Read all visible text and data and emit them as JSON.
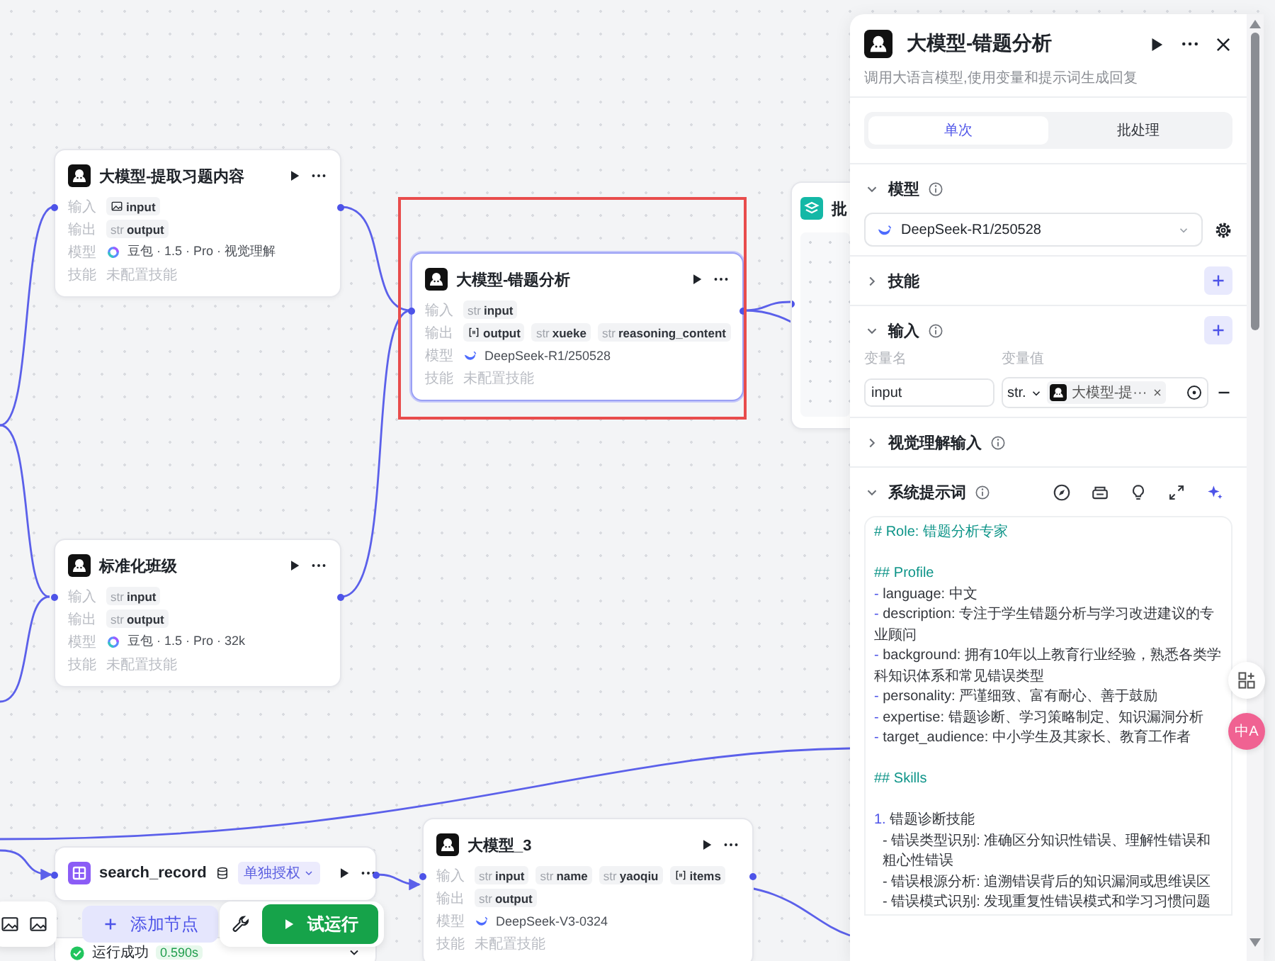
{
  "nodes": [
    {
      "title": "大模型-提取习题内容",
      "kind": "llm",
      "selected": false,
      "rows": [
        {
          "kind": "tags",
          "label": "输入",
          "tags": [
            {
              "kind": "image",
              "name": "input"
            }
          ]
        },
        {
          "kind": "tags",
          "label": "输出",
          "tags": [
            {
              "kind": "typed",
              "type": "str",
              "name": "output"
            }
          ]
        },
        {
          "kind": "model",
          "label": "模型",
          "model": {
            "kind": "doubao",
            "text": "豆包 · 1.5 · Pro · 视觉理解"
          }
        },
        {
          "kind": "text",
          "label": "技能",
          "text": "未配置技能"
        }
      ]
    },
    {
      "title": "大模型-错题分析",
      "kind": "llm",
      "selected": true,
      "rows": [
        {
          "kind": "tags",
          "label": "输入",
          "tags": [
            {
              "kind": "typed",
              "type": "str",
              "name": "input"
            }
          ]
        },
        {
          "kind": "tags",
          "label": "输出",
          "tags": [
            {
              "kind": "array",
              "name": "output"
            },
            {
              "kind": "typed",
              "type": "str",
              "name": "xueke"
            },
            {
              "kind": "typed",
              "type": "str",
              "name": "reasoning_content"
            }
          ]
        },
        {
          "kind": "model",
          "label": "模型",
          "model": {
            "kind": "deepseek",
            "text": "DeepSeek-R1/250528"
          }
        },
        {
          "kind": "text",
          "label": "技能",
          "text": "未配置技能"
        }
      ]
    },
    {
      "title": "标准化班级",
      "kind": "llm",
      "selected": false,
      "rows": [
        {
          "kind": "tags",
          "label": "输入",
          "tags": [
            {
              "kind": "typed",
              "type": "str",
              "name": "input"
            }
          ]
        },
        {
          "kind": "tags",
          "label": "输出",
          "tags": [
            {
              "kind": "typed",
              "type": "str",
              "name": "output"
            }
          ]
        },
        {
          "kind": "model",
          "label": "模型",
          "model": {
            "kind": "doubao",
            "text": "豆包 · 1.5 · Pro · 32k"
          }
        },
        {
          "kind": "text",
          "label": "技能",
          "text": "未配置技能"
        }
      ]
    },
    {
      "title": "search_record",
      "kind": "table",
      "selected": false,
      "badge": "单独授权",
      "status": {
        "text": "运行成功",
        "time": "0.590s"
      }
    },
    {
      "title": "大模型_3",
      "kind": "llm",
      "selected": false,
      "rows": [
        {
          "kind": "tags",
          "label": "输入",
          "tags": [
            {
              "kind": "typed",
              "type": "str",
              "name": "input"
            },
            {
              "kind": "typed",
              "type": "str",
              "name": "name"
            },
            {
              "kind": "typed",
              "type": "str",
              "name": "yaoqiu"
            },
            {
              "kind": "array",
              "name": "items"
            }
          ]
        },
        {
          "kind": "tags",
          "label": "输出",
          "tags": [
            {
              "kind": "typed",
              "type": "str",
              "name": "output"
            }
          ]
        },
        {
          "kind": "model",
          "label": "模型",
          "model": {
            "kind": "deepseek",
            "text": "DeepSeek-V3-0324"
          }
        },
        {
          "kind": "text",
          "label": "技能",
          "text": "未配置技能"
        }
      ]
    },
    {
      "title": "批",
      "kind": "batch",
      "selected": false
    }
  ],
  "toolbar": {
    "add_node": "添加节点",
    "run": "试运行"
  },
  "panel": {
    "title": "大模型-错题分析",
    "subtitle": "调用大语言模型,使用变量和提示词生成回复",
    "tabs": [
      {
        "label": "单次",
        "selected": true
      },
      {
        "label": "批处理",
        "selected": false
      }
    ],
    "sections": [
      {
        "kind": "model",
        "title": "模型",
        "expanded": true,
        "info": true,
        "addable": false,
        "value": "DeepSeek-R1/250528"
      },
      {
        "kind": "plain",
        "title": "技能",
        "expanded": false,
        "info": false,
        "addable": true
      },
      {
        "kind": "inputs",
        "title": "输入",
        "expanded": true,
        "info": true,
        "addable": true,
        "columns": [
          "变量名",
          "变量值"
        ],
        "rows": [
          {
            "name": "input",
            "type": "str.",
            "ref": "大模型-提···"
          }
        ]
      },
      {
        "kind": "plain",
        "title": "视觉理解输入",
        "expanded": false,
        "info": true,
        "addable": false
      },
      {
        "kind": "prompt",
        "title": "系统提示词",
        "expanded": true,
        "info": true,
        "addable": false,
        "lines": [
          {
            "kind": "heading",
            "text": "# Role: 错题分析专家"
          },
          {
            "kind": "blank"
          },
          {
            "kind": "heading",
            "text": "## Profile"
          },
          {
            "kind": "bullet",
            "marker": "-",
            "text": "language: 中文"
          },
          {
            "kind": "bullet",
            "marker": "-",
            "text": "description: 专注于学生错题分析与学习改进建议的专业顾问"
          },
          {
            "kind": "bullet",
            "marker": "-",
            "text": "background: 拥有10年以上教育行业经验，熟悉各类学科知识体系和常见错误类型"
          },
          {
            "kind": "bullet",
            "marker": "-",
            "text": "personality: 严谨细致、富有耐心、善于鼓励"
          },
          {
            "kind": "bullet",
            "marker": "-",
            "text": "expertise: 错题诊断、学习策略制定、知识漏洞分析"
          },
          {
            "kind": "bullet",
            "marker": "-",
            "text": "target_audience: 中小学生及其家长、教育工作者"
          },
          {
            "kind": "blank"
          },
          {
            "kind": "heading",
            "text": "## Skills"
          },
          {
            "kind": "blank"
          },
          {
            "kind": "bullet",
            "marker": "1.",
            "text": "错题诊断技能"
          },
          {
            "kind": "sub",
            "text": "- 错误类型识别: 准确区分知识性错误、理解性错误和粗心性错误"
          },
          {
            "kind": "sub",
            "text": "- 错误根源分析: 追溯错误背后的知识漏洞或思维误区"
          },
          {
            "kind": "sub",
            "text": "- 错误模式识别: 发现重复性错误模式和学习习惯问题"
          }
        ]
      }
    ]
  },
  "side_buttons": {
    "translate": "中A"
  }
}
